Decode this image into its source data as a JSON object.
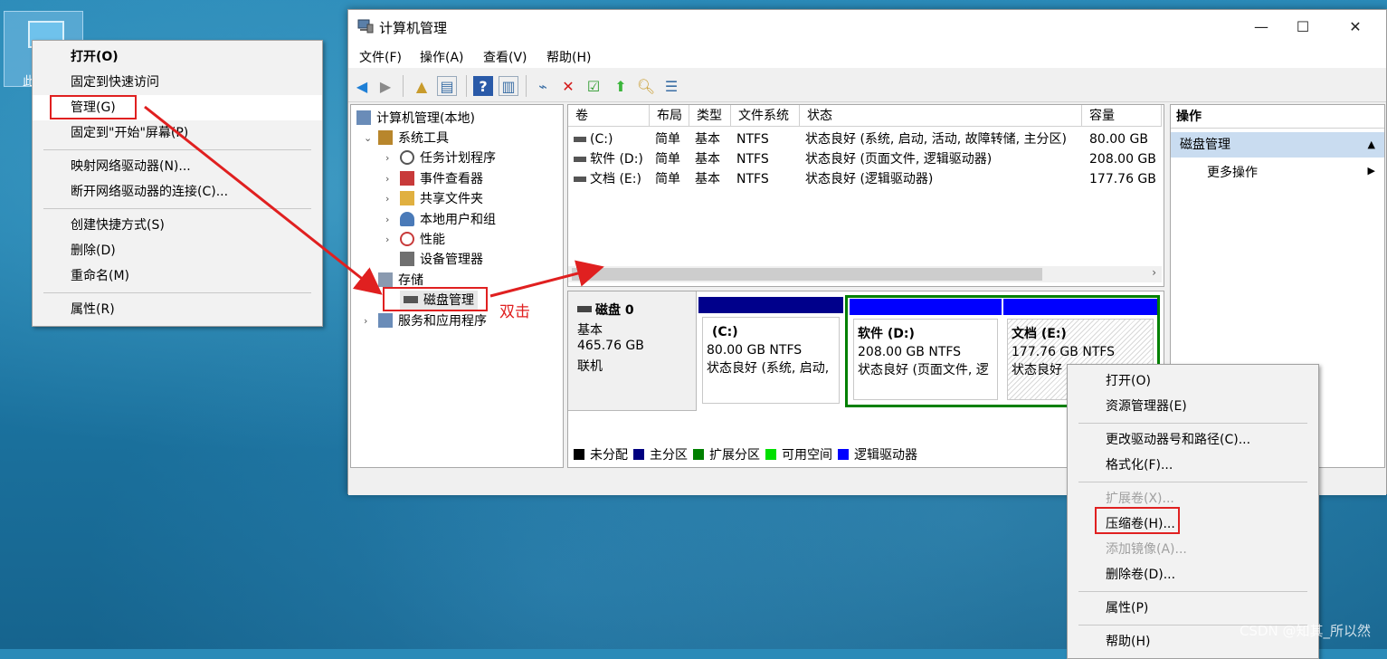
{
  "desktop": {
    "icon_label": "此"
  },
  "left_menu": {
    "items": [
      {
        "label": "打开(O)",
        "bold": true
      },
      {
        "label": "固定到快速访问"
      },
      {
        "label": "管理(G)",
        "highlight": true
      },
      {
        "label": "固定到\"开始\"屏幕(P)"
      },
      {
        "sep": true
      },
      {
        "label": "映射网络驱动器(N)..."
      },
      {
        "label": "断开网络驱动器的连接(C)..."
      },
      {
        "sep": true
      },
      {
        "label": "创建快捷方式(S)"
      },
      {
        "label": "删除(D)"
      },
      {
        "label": "重命名(M)"
      },
      {
        "sep": true
      },
      {
        "label": "属性(R)"
      }
    ]
  },
  "window": {
    "title": "计算机管理",
    "controls": {
      "minimize": "—",
      "maximize": "☐",
      "close": "✕"
    },
    "menus": [
      "文件(F)",
      "操作(A)",
      "查看(V)",
      "帮助(H)"
    ]
  },
  "tree": {
    "root": "计算机管理(本地)",
    "system_tools": "系统工具",
    "task_scheduler": "任务计划程序",
    "event_viewer": "事件查看器",
    "shared_folders": "共享文件夹",
    "local_users": "本地用户和组",
    "performance": "性能",
    "device_manager": "设备管理器",
    "storage": "存储",
    "disk_management": "磁盘管理",
    "services": "服务和应用程序"
  },
  "annotation": {
    "double_click": "双击"
  },
  "volume_list": {
    "headers": [
      "卷",
      "布局",
      "类型",
      "文件系统",
      "状态",
      "容量"
    ],
    "rows": [
      [
        "(C:)",
        "简单",
        "基本",
        "NTFS",
        "状态良好 (系统, 启动, 活动, 故障转储, 主分区)",
        "80.00 GB"
      ],
      [
        "软件 (D:)",
        "简单",
        "基本",
        "NTFS",
        "状态良好 (页面文件, 逻辑驱动器)",
        "208.00 GB"
      ],
      [
        "文档 (E:)",
        "简单",
        "基本",
        "NTFS",
        "状态良好 (逻辑驱动器)",
        "177.76 GB"
      ]
    ]
  },
  "disk": {
    "name": "磁盘 0",
    "type": "基本",
    "size": "465.76 GB",
    "status": "联机",
    "partitions": [
      {
        "title": "(C:)",
        "size": "80.00 GB NTFS",
        "status": "状态良好 (系统, 启动,"
      },
      {
        "title": "软件  (D:)",
        "size": "208.00 GB NTFS",
        "status": "状态良好 (页面文件, 逻"
      },
      {
        "title": "文档  (E:)",
        "size": "177.76 GB NTFS",
        "status": "状态良好"
      }
    ]
  },
  "legend": [
    {
      "label": "未分配",
      "color": "#000000"
    },
    {
      "label": "主分区",
      "color": "#000080"
    },
    {
      "label": "扩展分区",
      "color": "#008000"
    },
    {
      "label": "可用空间",
      "color": "#00e000"
    },
    {
      "label": "逻辑驱动器",
      "color": "#0000ff"
    }
  ],
  "actions": {
    "header": "操作",
    "section": "磁盘管理",
    "more": "更多操作"
  },
  "right_menu": {
    "items": [
      {
        "label": "打开(O)"
      },
      {
        "label": "资源管理器(E)"
      },
      {
        "sep": true
      },
      {
        "label": "更改驱动器号和路径(C)..."
      },
      {
        "label": "格式化(F)..."
      },
      {
        "sep": true
      },
      {
        "label": "扩展卷(X)...",
        "disabled": true
      },
      {
        "label": "压缩卷(H)...",
        "highlight": true
      },
      {
        "label": "添加镜像(A)...",
        "disabled": true
      },
      {
        "label": "删除卷(D)..."
      },
      {
        "sep": true
      },
      {
        "label": "属性(P)"
      },
      {
        "sep": true
      },
      {
        "label": "帮助(H)"
      }
    ]
  },
  "watermark": "CSDN @知其_所以然",
  "colors": {
    "primary_bar": "#00008b",
    "logical_bar": "#0000ff",
    "extended_border": "#008000",
    "annotation": "#e02020"
  }
}
